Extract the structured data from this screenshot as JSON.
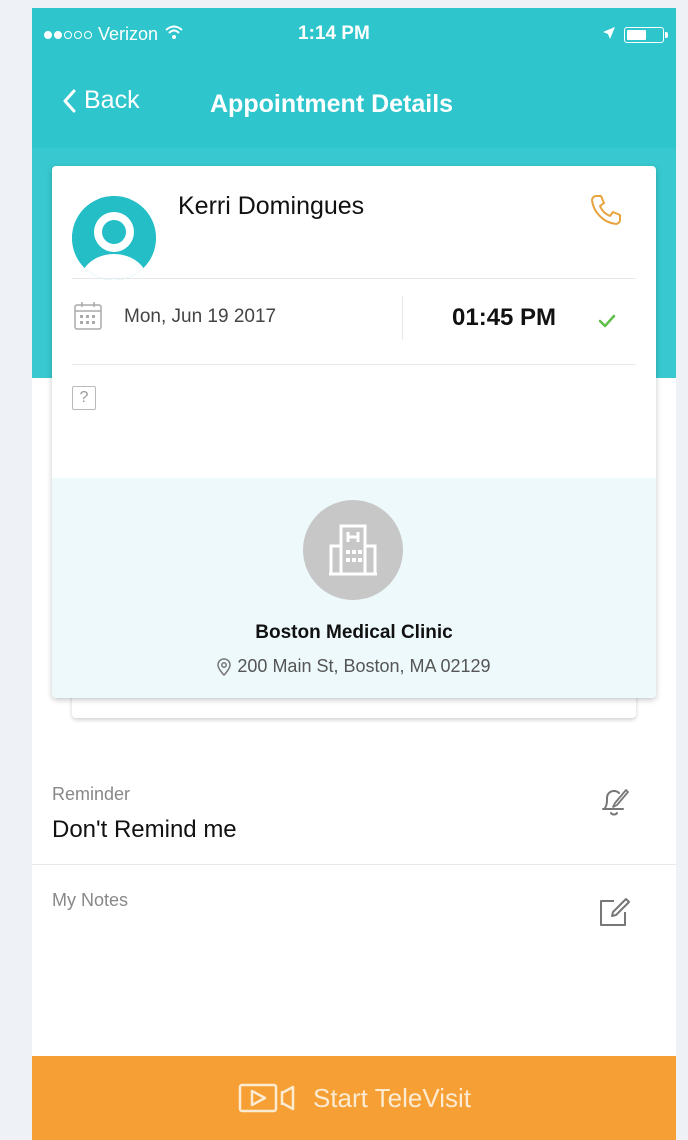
{
  "status_bar": {
    "carrier": "Verizon",
    "time": "1:14 PM",
    "signal_icon": "signal-dots-icon",
    "wifi_icon": "wifi-icon",
    "location_icon": "location-arrow-icon",
    "battery_icon": "battery-icon"
  },
  "nav": {
    "back_label": "Back",
    "title": "Appointment Details"
  },
  "appointment": {
    "patient_name": "Kerri Domingues",
    "date": "Mon, Jun 19  2017",
    "time": "01:45 PM",
    "help_glyph": "?",
    "clinic_name": "Boston Medical Clinic",
    "clinic_address": "200 Main St, Boston, MA 02129"
  },
  "reminder": {
    "label": "Reminder",
    "value": "Don't Remind me"
  },
  "notes": {
    "label": "My Notes"
  },
  "action": {
    "label": "Start TeleVisit"
  },
  "colors": {
    "teal": "#2ec5cc",
    "orange": "#f59f35",
    "phone_icon": "#e8a23d",
    "check": "#5fbf4a",
    "clinic_bg": "#edf9fa"
  }
}
